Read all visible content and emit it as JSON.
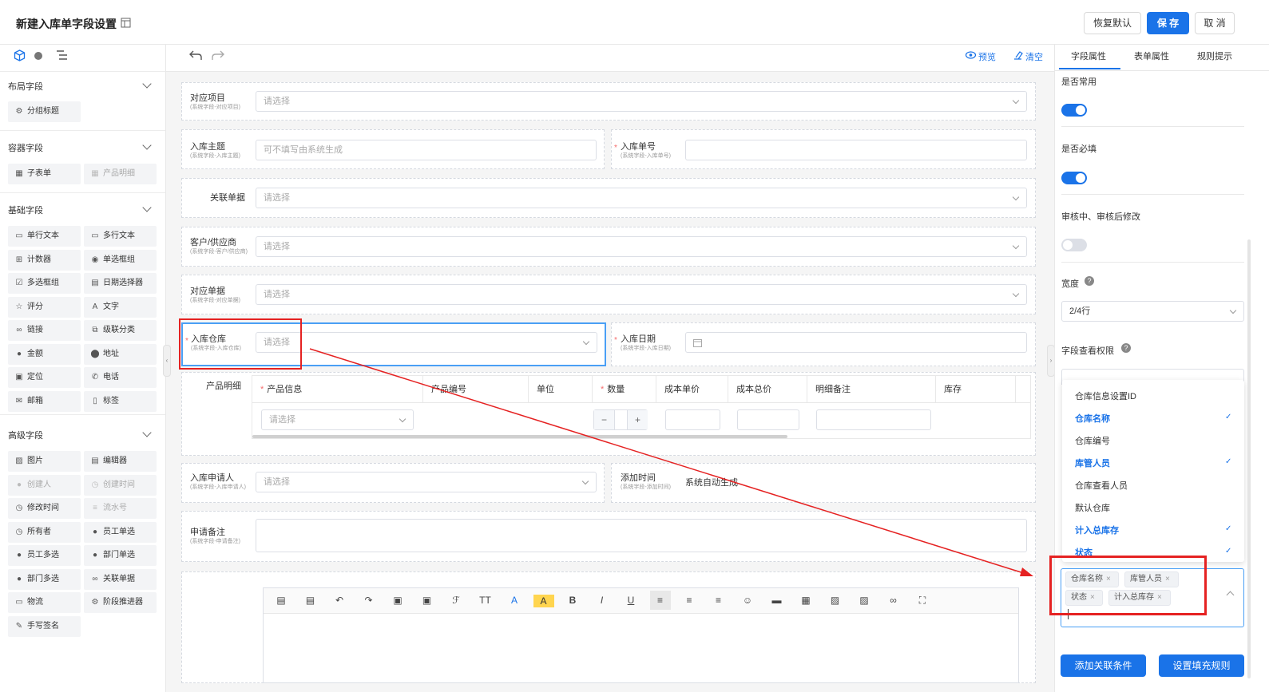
{
  "header": {
    "title": "新建入库单字段设置",
    "buttons": {
      "restore": "恢复默认",
      "save": "保 存",
      "cancel": "取 消"
    }
  },
  "left_panel": {
    "sections": [
      {
        "title": "布局字段",
        "items": [
          {
            "label": "分组标题",
            "icon": "group-title-icon",
            "enabled": true
          }
        ]
      },
      {
        "title": "容器字段",
        "items": [
          {
            "label": "子表单",
            "icon": "subform-icon",
            "enabled": true
          },
          {
            "label": "产品明细",
            "icon": "product-detail-icon",
            "enabled": false
          }
        ]
      },
      {
        "title": "基础字段",
        "items": [
          {
            "label": "单行文本",
            "icon": "single-text-icon",
            "enabled": true
          },
          {
            "label": "多行文本",
            "icon": "multi-text-icon",
            "enabled": true
          },
          {
            "label": "计数器",
            "icon": "counter-icon",
            "enabled": true
          },
          {
            "label": "单选框组",
            "icon": "radio-icon",
            "enabled": true
          },
          {
            "label": "多选框组",
            "icon": "checkbox-icon",
            "enabled": true
          },
          {
            "label": "日期选择器",
            "icon": "date-icon",
            "enabled": true
          },
          {
            "label": "评分",
            "icon": "star-icon",
            "enabled": true
          },
          {
            "label": "文字",
            "icon": "text-icon",
            "enabled": true
          },
          {
            "label": "链接",
            "icon": "link-icon",
            "enabled": true
          },
          {
            "label": "级联分类",
            "icon": "cascade-icon",
            "enabled": true
          },
          {
            "label": "金额",
            "icon": "amount-icon",
            "enabled": true
          },
          {
            "label": "地址",
            "icon": "location-pin-icon",
            "enabled": true
          },
          {
            "label": "定位",
            "icon": "position-icon",
            "enabled": true
          },
          {
            "label": "电话",
            "icon": "phone-icon",
            "enabled": true
          },
          {
            "label": "邮箱",
            "icon": "mail-icon",
            "enabled": true
          },
          {
            "label": "标签",
            "icon": "tag-icon",
            "enabled": true
          }
        ]
      },
      {
        "title": "高级字段",
        "items": [
          {
            "label": "图片",
            "icon": "image-icon",
            "enabled": true
          },
          {
            "label": "编辑器",
            "icon": "editor-icon",
            "enabled": true
          },
          {
            "label": "创建人",
            "icon": "creator-icon",
            "enabled": false
          },
          {
            "label": "创建时间",
            "icon": "create-time-icon",
            "enabled": false
          },
          {
            "label": "修改时间",
            "icon": "modify-time-icon",
            "enabled": true
          },
          {
            "label": "流水号",
            "icon": "serial-icon",
            "enabled": false
          },
          {
            "label": "所有者",
            "icon": "owner-icon",
            "enabled": true
          },
          {
            "label": "员工单选",
            "icon": "user-icon",
            "enabled": true
          },
          {
            "label": "员工多选",
            "icon": "users-icon",
            "enabled": true
          },
          {
            "label": "部门单选",
            "icon": "dept-icon",
            "enabled": true
          },
          {
            "label": "部门多选",
            "icon": "depts-icon",
            "enabled": true
          },
          {
            "label": "关联单据",
            "icon": "relation-icon",
            "enabled": true
          },
          {
            "label": "物流",
            "icon": "logistics-icon",
            "enabled": true
          },
          {
            "label": "阶段推进器",
            "icon": "stage-icon",
            "enabled": true
          },
          {
            "label": "手写签名",
            "icon": "signature-icon",
            "enabled": true
          }
        ]
      }
    ]
  },
  "toolbar": {
    "preview": "预览",
    "clear": "清空"
  },
  "form": {
    "placeholder_select": "请选择",
    "fields": {
      "project": {
        "label": "对应项目",
        "sub": "(系统字段-对应项目)"
      },
      "subject": {
        "label": "入库主题",
        "sub": "(系统字段-入库主题)",
        "placeholder": "可不填写由系统生成"
      },
      "number": {
        "label": "入库单号",
        "sub": "(系统字段-入库单号)"
      },
      "related": {
        "label": "关联单据"
      },
      "customer": {
        "label": "客户/供应商",
        "sub": "(系统字段-客户/供应商)"
      },
      "doc": {
        "label": "对应单据",
        "sub": "(系统字段-对应单据)"
      },
      "warehouse": {
        "label": "入库仓库",
        "sub": "(系统字段-入库仓库)"
      },
      "date": {
        "label": "入库日期",
        "sub": "(系统字段-入库日期)"
      },
      "product": {
        "label": "产品明细"
      },
      "applicant": {
        "label": "入库申请人",
        "sub": "(系统字段-入库申请人)"
      },
      "addtime": {
        "label": "添加时间",
        "sub": "(系统字段-添加时间)",
        "value": "系统自动生成"
      },
      "note": {
        "label": "申请备注",
        "sub": "(系统字段-申请备注)"
      }
    },
    "table_headers": [
      "产品信息",
      "产品编号",
      "单位",
      "数量",
      "成本单价",
      "成本总价",
      "明细备注",
      "库存"
    ]
  },
  "right_panel": {
    "tabs": [
      "字段属性",
      "表单属性",
      "规则提示"
    ],
    "common": "是否常用",
    "required": "是否必填",
    "editable": "审核中、审核后修改",
    "width_label": "宽度",
    "width_value": "2/4行",
    "permission": "字段查看权限",
    "options": [
      {
        "label": "仓库信息设置ID",
        "selected": false
      },
      {
        "label": "仓库名称",
        "selected": true
      },
      {
        "label": "仓库编号",
        "selected": false
      },
      {
        "label": "库管人员",
        "selected": true
      },
      {
        "label": "仓库查看人员",
        "selected": false
      },
      {
        "label": "默认仓库",
        "selected": false
      },
      {
        "label": "计入总库存",
        "selected": true
      },
      {
        "label": "状态",
        "selected": true
      }
    ],
    "tags": [
      "仓库名称",
      "库管人员",
      "状态",
      "计入总库存"
    ],
    "add_condition": "添加关联条件",
    "fill_rule": "设置填充规则"
  }
}
